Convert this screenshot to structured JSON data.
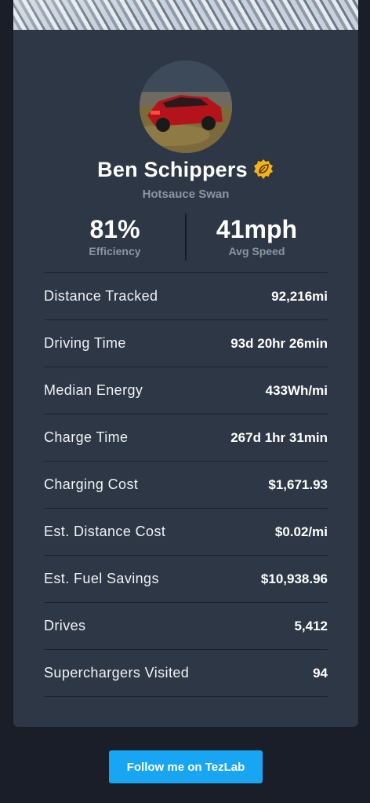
{
  "profile": {
    "name": "Ben Schippers",
    "subtitle": "Hotsauce Swan",
    "badge_icon": "leaf-badge-icon",
    "avatar_icon": "red-car-photo"
  },
  "stats": {
    "efficiency": {
      "value": "81%",
      "label": "Efficiency"
    },
    "avg_speed": {
      "value": "41mph",
      "label": "Avg Speed"
    }
  },
  "details": [
    {
      "label": "Distance Tracked",
      "value": "92,216mi"
    },
    {
      "label": "Driving Time",
      "value": "93d 20hr 26min"
    },
    {
      "label": "Median Energy",
      "value": "433Wh/mi"
    },
    {
      "label": "Charge Time",
      "value": "267d 1hr 31min"
    },
    {
      "label": "Charging Cost",
      "value": "$1,671.93"
    },
    {
      "label": "Est. Distance Cost",
      "value": "$0.02/mi"
    },
    {
      "label": "Est. Fuel Savings",
      "value": "$10,938.96"
    },
    {
      "label": "Drives",
      "value": "5,412"
    },
    {
      "label": "Superchargers Visited",
      "value": "94"
    }
  ],
  "follow_button": {
    "label": "Follow me on TezLab"
  },
  "colors": {
    "background": "#191e29",
    "card": "#2e3745",
    "muted_text": "#8c95a3",
    "accent_button": "#18a6f4",
    "badge": "#f2b31b"
  }
}
